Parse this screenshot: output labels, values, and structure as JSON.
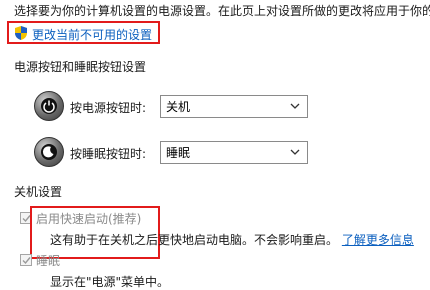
{
  "intro_text": "选择要为你的计算机设置的电源设置。在此页上对设置所做的更改将应用于你的",
  "change_settings_link": "更改当前不可用的设置",
  "power_section": {
    "title": "电源按钮和睡眠按钮设置",
    "power_button": {
      "label": "按电源按钮时:",
      "value": "关机",
      "icon": "power-button-icon"
    },
    "sleep_button": {
      "label": "按睡眠按钮时:",
      "value": "睡眠",
      "icon": "sleep-button-icon"
    }
  },
  "shutdown_section": {
    "title": "关机设置",
    "fast_startup": {
      "label": "启用快速启动(推荐)",
      "description": "这有助于在关机之后更快地启动电脑。不会影响重启。",
      "learn_more": "了解更多信息",
      "checked": true
    },
    "sleep": {
      "label": "睡眠",
      "description": "显示在\"电源\"菜单中。",
      "checked": true
    }
  },
  "colors": {
    "highlight_border": "#e21b1b",
    "link": "#0b5fbf",
    "disabled_text": "#8a8a8a"
  }
}
